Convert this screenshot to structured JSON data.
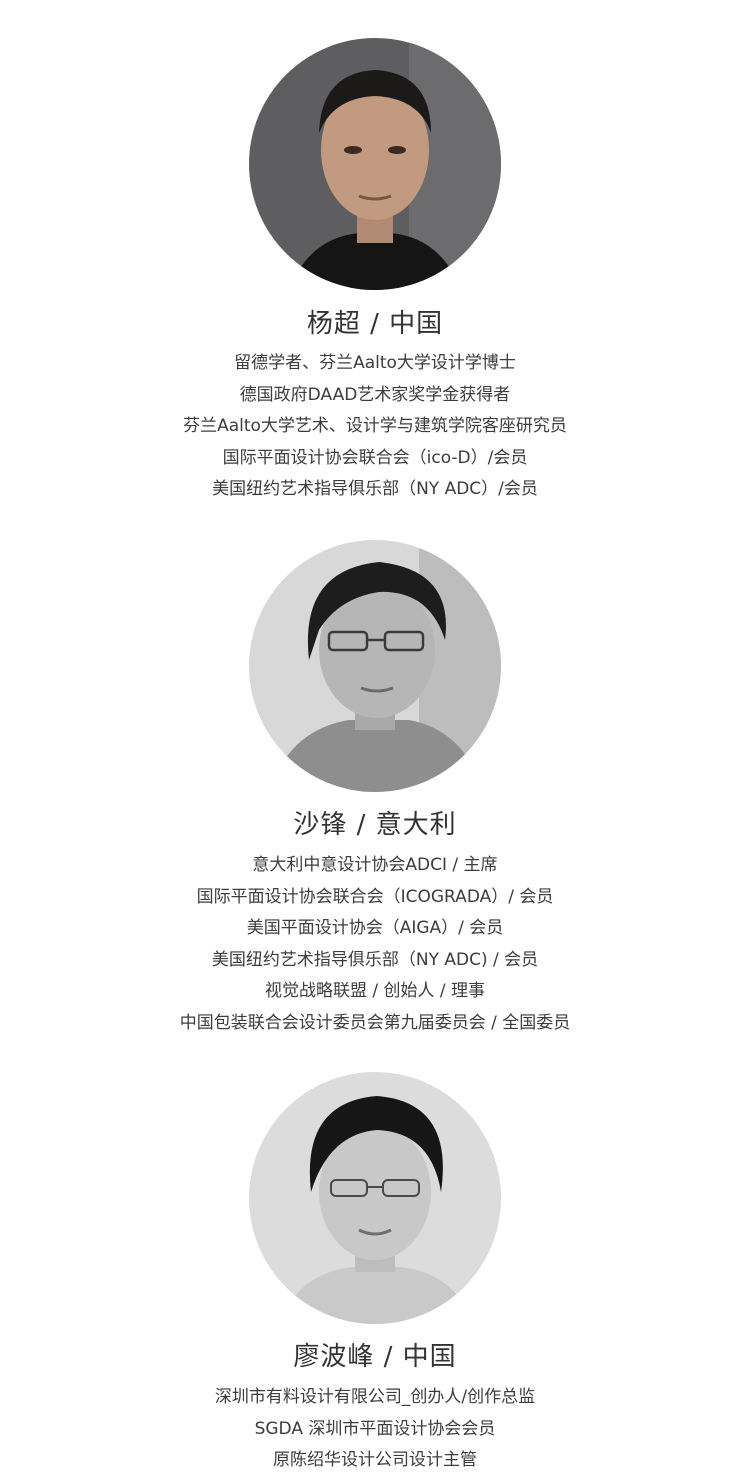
{
  "profiles": [
    {
      "name": "杨超 / 中国",
      "lines": [
        "留德学者、芬兰Aalto大学设计学博士",
        "德国政府DAAD艺术家奖学金获得者",
        "芬兰Aalto大学艺术、设计学与建筑学院客座研究员",
        "国际平面设计协会联合会（ico-D）/会员",
        "美国纽约艺术指导俱乐部（NY ADC）/会员"
      ]
    },
    {
      "name": "沙锋 / 意大利",
      "lines": [
        "意大利中意设计协会ADCI / 主席",
        "国际平面设计协会联合会（ICOGRADA）/ 会员",
        "美国平面设计协会（AIGA）/ 会员",
        "美国纽约艺术指导俱乐部（NY ADC) / 会员",
        "视觉战略联盟 / 创始人 / 理事",
        "中国包装联合会设计委员会第九届委员会 / 全国委员"
      ]
    },
    {
      "name": "廖波峰 / 中国",
      "lines": [
        "深圳市有料设计有限公司_创办人/创作总监",
        "SGDA 深圳市平面设计协会会员",
        "原陈绍华设计公司设计主管"
      ]
    }
  ]
}
